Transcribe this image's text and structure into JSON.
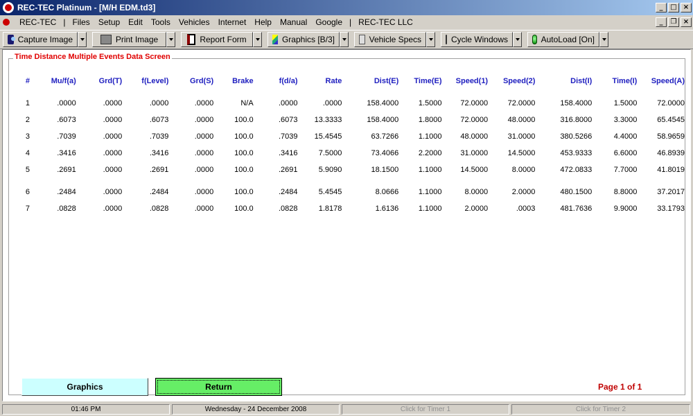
{
  "window": {
    "title": "REC-TEC Platinum - [M/H    EDM.td3]"
  },
  "menu": {
    "items": [
      "REC-TEC",
      "|",
      "Files",
      "Setup",
      "Edit",
      "Tools",
      "Vehicles",
      "Internet",
      "Help",
      "Manual",
      "Google",
      "|",
      "REC-TEC LLC"
    ]
  },
  "toolbar": {
    "capture_image": "Capture Image",
    "print_image": "Print Image",
    "report_form": "Report Form",
    "graphics": "Graphics [B/3]",
    "vehicle_specs": "Vehicle Specs",
    "cycle_windows": "Cycle Windows",
    "autoload": "AutoLoad [On]"
  },
  "screen": {
    "title": "Time Distance Multiple Events Data Screen",
    "page_indicator": "Page 1 of 1",
    "graphics_button": "Graphics",
    "return_button": "Return"
  },
  "table": {
    "headers": [
      "#",
      "Mu/f(a)",
      "Grd(T)",
      "f(Level)",
      "Grd(S)",
      "Brake",
      "f(d/a)",
      "Rate",
      "Dist(E)",
      "Time(E)",
      "Speed(1)",
      "Speed(2)",
      "Dist(I)",
      "Time(I)",
      "Speed(A)"
    ],
    "rows": [
      [
        "1",
        ".0000",
        ".0000",
        ".0000",
        ".0000",
        "N/A",
        ".0000",
        ".0000",
        "158.4000",
        "1.5000",
        "72.0000",
        "72.0000",
        "158.4000",
        "1.5000",
        "72.0000"
      ],
      [
        "2",
        ".6073",
        ".0000",
        ".6073",
        ".0000",
        "100.0",
        ".6073",
        "13.3333",
        "158.4000",
        "1.8000",
        "72.0000",
        "48.0000",
        "316.8000",
        "3.3000",
        "65.4545"
      ],
      [
        "3",
        ".7039",
        ".0000",
        ".7039",
        ".0000",
        "100.0",
        ".7039",
        "15.4545",
        "63.7266",
        "1.1000",
        "48.0000",
        "31.0000",
        "380.5266",
        "4.4000",
        "58.9659"
      ],
      [
        "4",
        ".3416",
        ".0000",
        ".3416",
        ".0000",
        "100.0",
        ".3416",
        "7.5000",
        "73.4066",
        "2.2000",
        "31.0000",
        "14.5000",
        "453.9333",
        "6.6000",
        "46.8939"
      ],
      [
        "5",
        ".2691",
        ".0000",
        ".2691",
        ".0000",
        "100.0",
        ".2691",
        "5.9090",
        "18.1500",
        "1.1000",
        "14.5000",
        "8.0000",
        "472.0833",
        "7.7000",
        "41.8019"
      ],
      [
        "6",
        ".2484",
        ".0000",
        ".2484",
        ".0000",
        "100.0",
        ".2484",
        "5.4545",
        "8.0666",
        "1.1000",
        "8.0000",
        "2.0000",
        "480.1500",
        "8.8000",
        "37.2017"
      ],
      [
        "7",
        ".0828",
        ".0000",
        ".0828",
        ".0000",
        "100.0",
        ".0828",
        "1.8178",
        "1.6136",
        "1.1000",
        "2.0000",
        ".0003",
        "481.7636",
        "9.9000",
        "33.1793"
      ]
    ]
  },
  "status": {
    "time": "01:46 PM",
    "date": "Wednesday  -  24 December 2008",
    "timer1": "Click for Timer 1",
    "timer2": "Click for Timer 2"
  },
  "colors": {
    "header_text": "#2020c0",
    "screen_title": "#e00000",
    "graphics_button": "#ccffff",
    "return_button": "#66ee66"
  }
}
